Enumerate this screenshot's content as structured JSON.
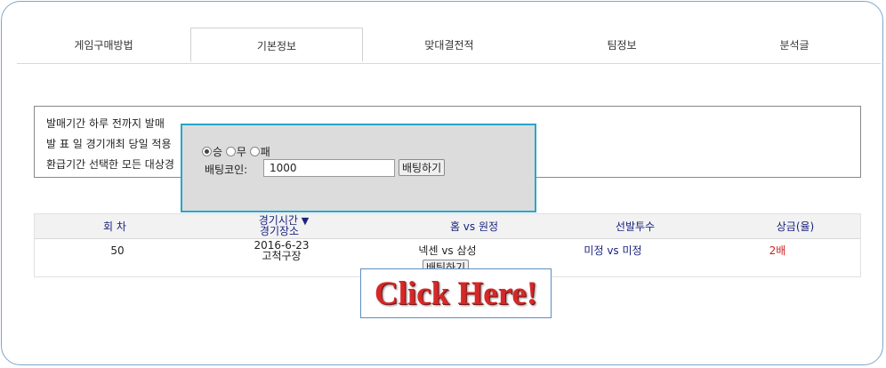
{
  "tabs": [
    "게임구매방법",
    "기본정보",
    "맞대결전적",
    "팀정보",
    "분석글"
  ],
  "active_tab": "기본정보",
  "notice": {
    "line1": "발매기간 하루 전까지 발매",
    "line2": "발 표 일 경기개최 당일 적용",
    "line3": "환급기간 선택한 모든 대상경"
  },
  "table": {
    "headers": {
      "round": "회 차",
      "time_line1": "경기시간",
      "sort_icon": "▼",
      "time_line2": "경기장소",
      "match": "홈 vs 원정",
      "pitchers": "선발투수",
      "prize": "상금(율)"
    },
    "row": {
      "round": "50",
      "date": "2016-6-23",
      "venue": "고척구장",
      "match": "넥센 vs 삼성",
      "pitchers": "미정 vs 미정",
      "prize": "2배"
    },
    "bet_button": "배팅하기"
  },
  "popup": {
    "options": [
      "승",
      "무",
      "패"
    ],
    "selected": "승",
    "coin_label": "배팅코인:",
    "coin_value": "1000",
    "bet_button": "배팅하기"
  },
  "banner": {
    "text": "Click Here!"
  },
  "colors": {
    "frame_border": "#7ea6c9",
    "popup_border": "#29a6c7",
    "header_text": "#1a237e",
    "prize_text": "#cc2222",
    "banner_text": "#d62828"
  }
}
